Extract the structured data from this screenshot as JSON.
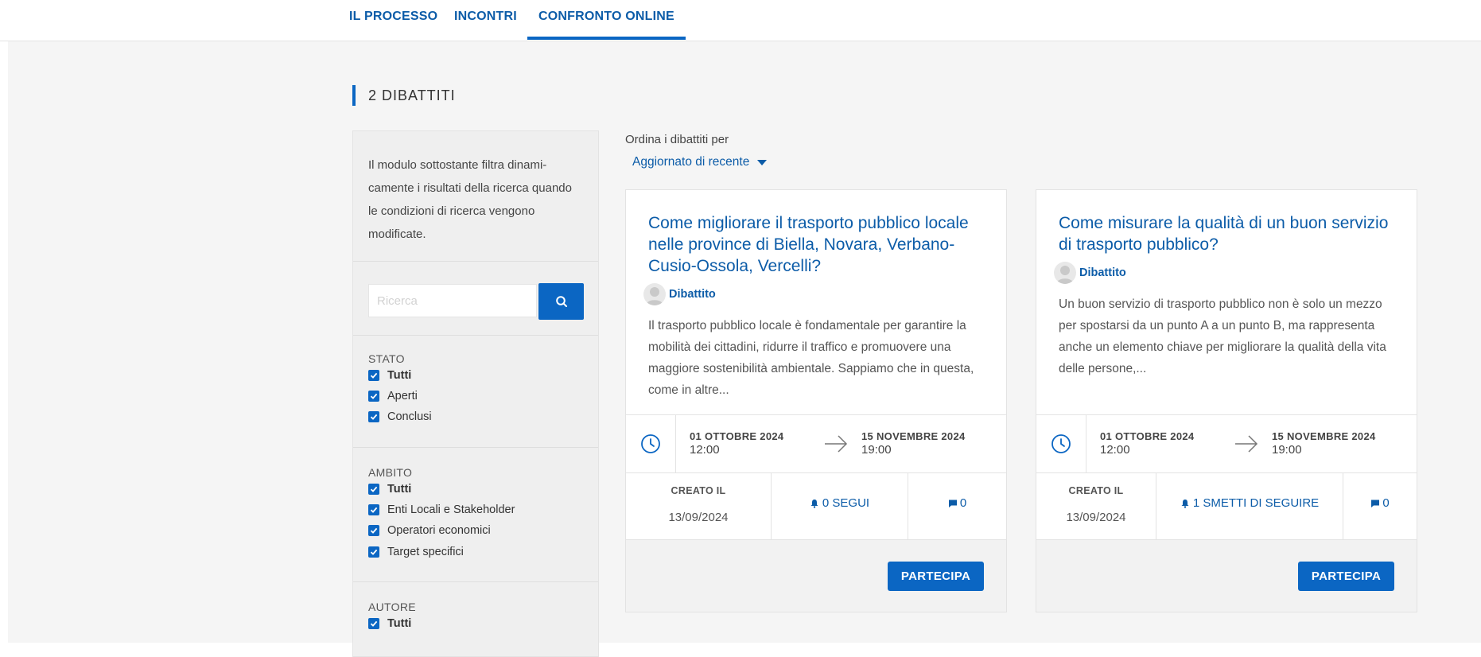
{
  "nav": {
    "tabs": [
      {
        "label": "IL PROCESSO"
      },
      {
        "label": "INCONTRI"
      },
      {
        "label": "CONFRONTO ONLINE",
        "active": true
      }
    ]
  },
  "section": {
    "title": "2 DIBATTITI"
  },
  "sidebar": {
    "intro": "Il modulo sottostante filtra dinami­camente i risultati della ricerca quando le condizioni di ricerca vengono modificate.",
    "search": {
      "placeholder": "Ricerca",
      "value": ""
    },
    "filters": [
      {
        "title": "STATO",
        "options": [
          {
            "label": "Tutti",
            "checked": true,
            "bold": true
          },
          {
            "label": "Aperti",
            "checked": true
          },
          {
            "label": "Conclusi",
            "checked": true
          }
        ]
      },
      {
        "title": "AMBITO",
        "options": [
          {
            "label": "Tutti",
            "checked": true,
            "bold": true
          },
          {
            "label": "Enti Locali e Stakeholder",
            "checked": true
          },
          {
            "label": "Operatori economici",
            "checked": true
          },
          {
            "label": "Target specifici",
            "checked": true
          }
        ]
      },
      {
        "title": "AUTORE",
        "options": [
          {
            "label": "Tutti",
            "checked": true,
            "bold": true
          }
        ]
      }
    ]
  },
  "sort": {
    "label": "Ordina i dibattiti per",
    "selected": "Aggiornato di recente"
  },
  "cards": [
    {
      "title": "Come migliorare il trasporto pubblico locale nelle province di Biella, Novara, Verbano-Cusio-Ossola, Vercelli?",
      "type": "Dibattito",
      "description": "Il trasporto pubblico locale è fondamentale per garan­tire la mobilità dei cittadini, ridurre il traffico e promuo­vere una maggiore sostenibilità ambientale. Sappiamo che in questa, come in altre...",
      "start_date": "01 OTTOBRE 2024",
      "start_time": "12:00",
      "end_date": "15 NOVEMBRE 2024",
      "end_time": "19:00",
      "created_label": "CREATO IL",
      "created_date": "13/09/2024",
      "follow_label": "0 SEGUI",
      "comments": "0",
      "button": "PARTECIPA"
    },
    {
      "title": "Come misurare la qualità di un buon servi­zio di trasporto pubblico?",
      "type": "Dibattito",
      "description": "Un buon servizio di trasporto pubblico non è solo un mezzo per spostarsi da un punto A a un punto B, ma rappresenta anche un elemento chiave per migliorare la qualità della vita delle persone,...",
      "start_date": "01 OTTOBRE 2024",
      "start_time": "12:00",
      "end_date": "15 NOVEMBRE 2024",
      "end_time": "19:00",
      "created_label": "CREATO IL",
      "created_date": "13/09/2024",
      "follow_label": "1 SMETTI DI SEGUIRE",
      "comments": "0",
      "button": "PARTECIPA"
    }
  ],
  "colors": {
    "accent": "#0b66c3",
    "link": "#0c5ca8",
    "background": "#f5f5f5"
  }
}
